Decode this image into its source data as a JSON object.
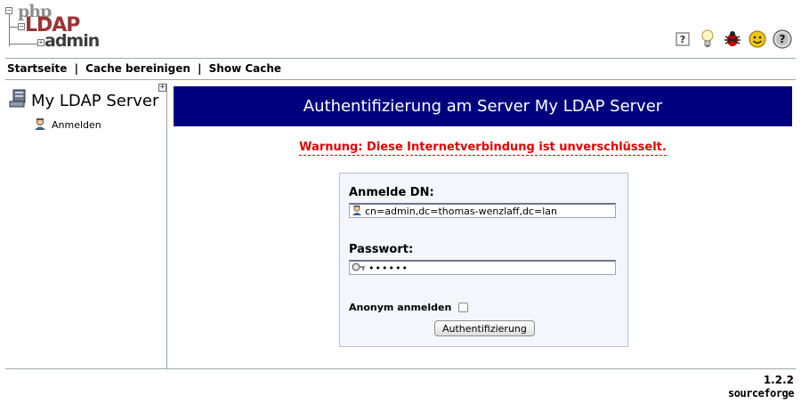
{
  "logo": {
    "php": "php",
    "ldap": "LDAP",
    "admin": "admin"
  },
  "header_icons": [
    "help-icon",
    "lightbulb-icon",
    "bug-icon",
    "smiley-icon",
    "question-icon"
  ],
  "nav": {
    "home": "Startseite",
    "purge_cache": "Cache bereinigen",
    "show_cache": "Show Cache",
    "separator": "|"
  },
  "tree": {
    "server_name": "My LDAP Server",
    "expand_symbol": "+",
    "login_item": "Anmelden"
  },
  "main": {
    "banner_title": "Authentifizierung am Server My LDAP Server",
    "warning": "Warnung: Diese Internetverbindung ist unverschlüsselt."
  },
  "login_form": {
    "dn_label": "Anmelde DN:",
    "dn_value": "cn=admin,dc=thomas-wenzlaff,dc=lan",
    "password_label": "Passwort:",
    "password_value": "••••••",
    "anonymous_label": "Anonym anmelden",
    "anonymous_checked": false,
    "submit_label": "Authentifizierung"
  },
  "footer": {
    "version": "1.2.2",
    "sourceforge": "sourceforge"
  },
  "colors": {
    "banner_bg": "#00007f",
    "warning": "#e10000",
    "ldap_logo": "#9c3233"
  }
}
